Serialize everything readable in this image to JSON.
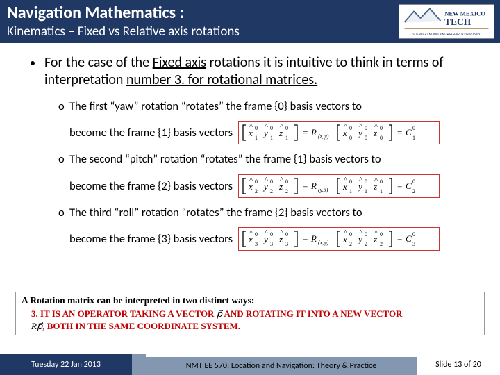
{
  "header": {
    "title": "Navigation Mathematics :",
    "subtitle": "Kinematics – Fixed vs Relative axis rotations",
    "logo_top": "NEW MEXICO TECH",
    "logo_bottom": "SCIENCE • ENGINEERING • RESEARCH UNIVERSITY"
  },
  "main_bullet": {
    "pre": "For the case of the ",
    "u1": "Fixed axis",
    "mid": " rotations it is intuitive to think in terms of interpretation ",
    "u2": "number 3. for rotational matrices.",
    "post": ""
  },
  "subs": [
    {
      "lead": "The first “yaw” rotation “rotates” the frame {0} basis vectors to",
      "cont": "become the frame {1} basis vectors",
      "eq": {
        "lhs_sup": "0",
        "lhs_x": "x",
        "lhs_y": "y",
        "lhs_z": "z",
        "lhs_sub": "1",
        "rfun": "R",
        "rargs": "(z,ψ)",
        "rhs_sup": "0",
        "rhs_sub": "0",
        "c_sup": "0",
        "c_sub": "1"
      }
    },
    {
      "lead": "The second “pitch” rotation “rotates” the frame {1} basis vectors to",
      "cont": "become the frame {2} basis vectors",
      "eq": {
        "lhs_sup": "0",
        "lhs_x": "x",
        "lhs_y": "y",
        "lhs_z": "z",
        "lhs_sub": "2",
        "rfun": "R",
        "rargs": "(y,θ)",
        "rhs_sup": "0",
        "rhs_sub": "1",
        "c_sup": "0",
        "c_sub": "2"
      }
    },
    {
      "lead": "The third “roll” rotation “rotates” the frame {2} basis vectors to",
      "cont": "become the frame {3} basis vectors",
      "eq": {
        "lhs_sup": "0",
        "lhs_x": "x",
        "lhs_y": "y",
        "lhs_z": "z",
        "lhs_sub": "3",
        "rfun": "R",
        "rargs": "(x,φ)",
        "rhs_sup": "0",
        "rhs_sub": "2",
        "c_sup": "0",
        "c_sub": "3"
      }
    }
  ],
  "interp": {
    "heading": "A Rotation matrix can be interpreted in two distinct ways:",
    "line1a": "3. IT IS AN OPERATOR TAKING A VECTOR ",
    "vec1": "p⃗",
    "line1b": " AND ROTATING IT INTO A NEW VECTOR",
    "line2a": "Rp⃗",
    "line2b": ", BOTH IN THE SAME COORDINATE SYSTEM."
  },
  "footer": {
    "date": "Tuesday 22 Jan 2013",
    "course": "NMT EE 570: Location and Navigation: Theory & Practice",
    "page": "Slide 13 of 20"
  }
}
